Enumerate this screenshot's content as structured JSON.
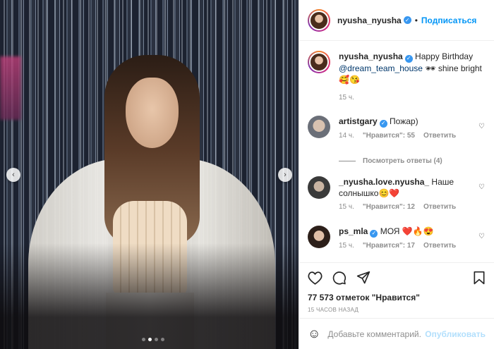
{
  "post": {
    "author": "nyusha_nyusha",
    "follow_label": "Подписаться",
    "separator": "•",
    "nav_prev": "‹",
    "nav_next": "›",
    "caption": {
      "text_before": "Happy Birthday",
      "mention": "@dream_team_house",
      "text_after": "🕶 shine bright",
      "emojis": "🥰😘",
      "time": "15 ч."
    },
    "comments": [
      {
        "user": "artistgary",
        "verified": true,
        "text": "Пожар)",
        "time": "14 ч.",
        "likes": "\"Нравится\": 55",
        "reply": "Ответить",
        "view_replies": "Посмотреть ответы (4)"
      },
      {
        "user": "_nyusha.love.nyusha_",
        "verified": false,
        "text": "Наше солнышко😊❤️",
        "time": "15 ч.",
        "likes": "\"Нравится\": 12",
        "reply": "Ответить"
      },
      {
        "user": "ps_mla",
        "verified": true,
        "text": "МОЯ ❤️🔥😍",
        "time": "15 ч.",
        "likes": "\"Нравится\": 17",
        "reply": "Ответить"
      }
    ],
    "likes_text": "77 573 отметок \"Нравится\"",
    "timestamp": "15 ЧАСОВ НАЗАД",
    "comment_placeholder": "Добавьте комментарий...",
    "publish_label": "Опубликовать",
    "carousel": {
      "count": 4,
      "active": 2
    }
  },
  "colors": {
    "accent": "#0095f6",
    "verified": "#3897f0",
    "muted": "#8e8e8e",
    "publish_disabled": "#b2dffc"
  },
  "icons": [
    "heart-icon",
    "comment-icon",
    "share-icon",
    "bookmark-icon",
    "emoji-icon",
    "verified-icon"
  ]
}
